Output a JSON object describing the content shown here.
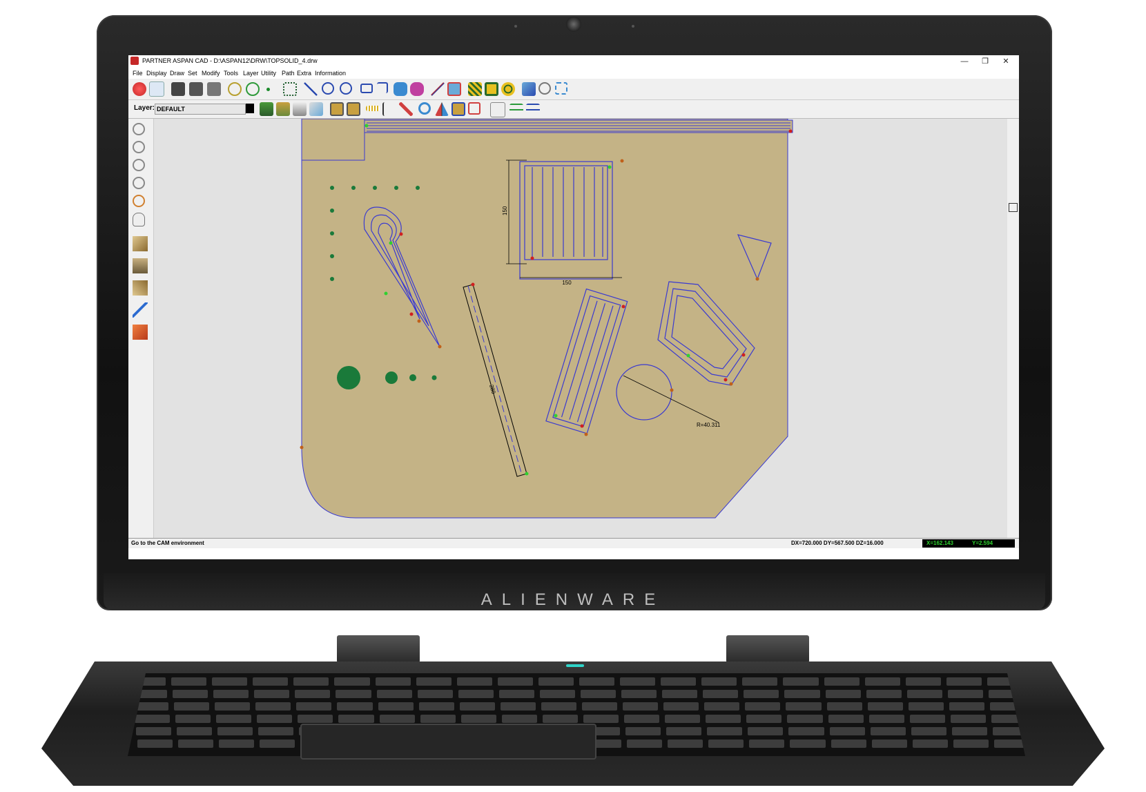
{
  "device": {
    "brand": "ALIENWARE"
  },
  "window": {
    "title": "PARTNER ASPAN CAD - D:\\ASPAN12\\DRW\\TOPSOLID_4.drw",
    "minimize": "—",
    "restore": "❐",
    "close": "✕"
  },
  "menu": [
    "File",
    "Display",
    "Draw",
    "Set",
    "Modify",
    "Tools",
    "Layer",
    "Utility",
    "Path",
    "Extra",
    "Information"
  ],
  "layer": {
    "label": "Layer:",
    "value": "DEFAULT"
  },
  "drawing": {
    "dim_horizontal": "150",
    "dim_vertical": "150",
    "dim_slot": "280",
    "radius_label": "R=40.311"
  },
  "status": {
    "message": "Go to the CAM environment",
    "dimensions": "DX=720.000 DY=567.500 DZ=16.000",
    "x": "X=162.143",
    "y": "Y=2.594"
  },
  "colors": {
    "sheet": "#c4b386",
    "toolpath": "#3a3ad0",
    "drill": "#1a7a3a"
  }
}
